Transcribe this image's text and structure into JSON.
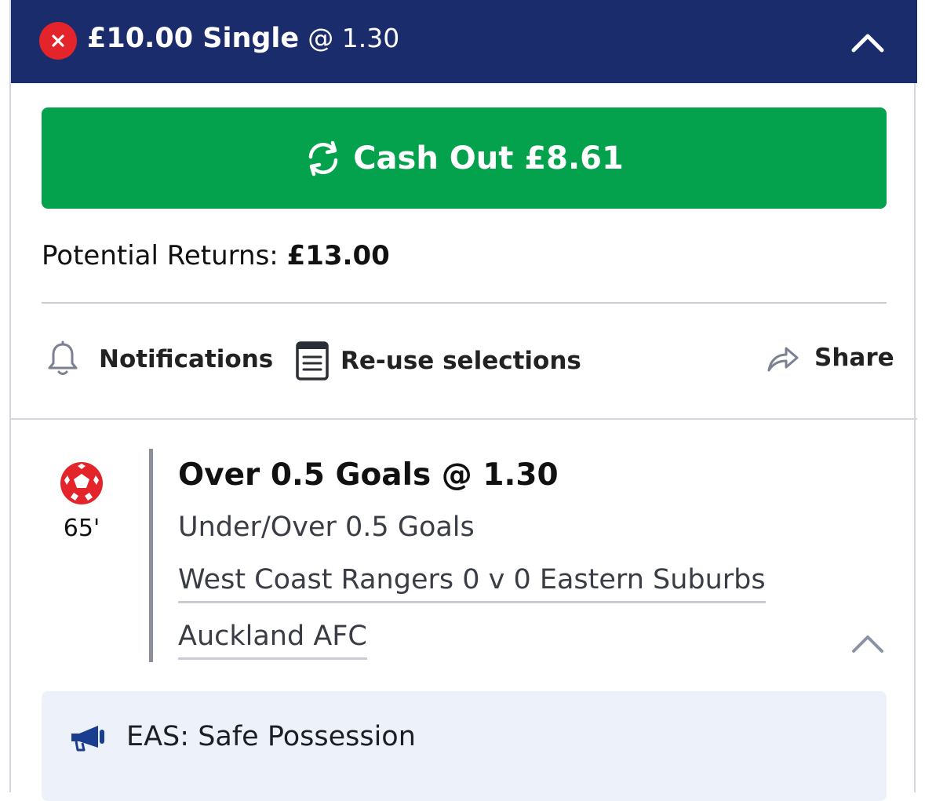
{
  "bet": {
    "stake": "£10.00 Single",
    "odds": "@ 1.30",
    "status_icon": "close-icon",
    "header_bg": "#1a2c6b",
    "status_color": "#e3242b"
  },
  "cashout": {
    "label": "Cash Out £8.61",
    "icon": "refresh-icon",
    "color": "#04a24c"
  },
  "returns": {
    "label": "Potential Returns:",
    "value": "£13.00"
  },
  "actions": {
    "notifications": "Notifications",
    "reuse": "Re-use selections",
    "share": "Share"
  },
  "selection": {
    "sport_icon": "football-icon",
    "time": "65'",
    "title": "Over 0.5 Goals @ 1.30",
    "market": "Under/Over 0.5 Goals",
    "event": "West Coast Rangers 0 v 0 Eastern Suburbs",
    "competition": "Auckland AFC"
  },
  "info": {
    "icon": "megaphone-icon",
    "text": "EAS: Safe Possession"
  }
}
